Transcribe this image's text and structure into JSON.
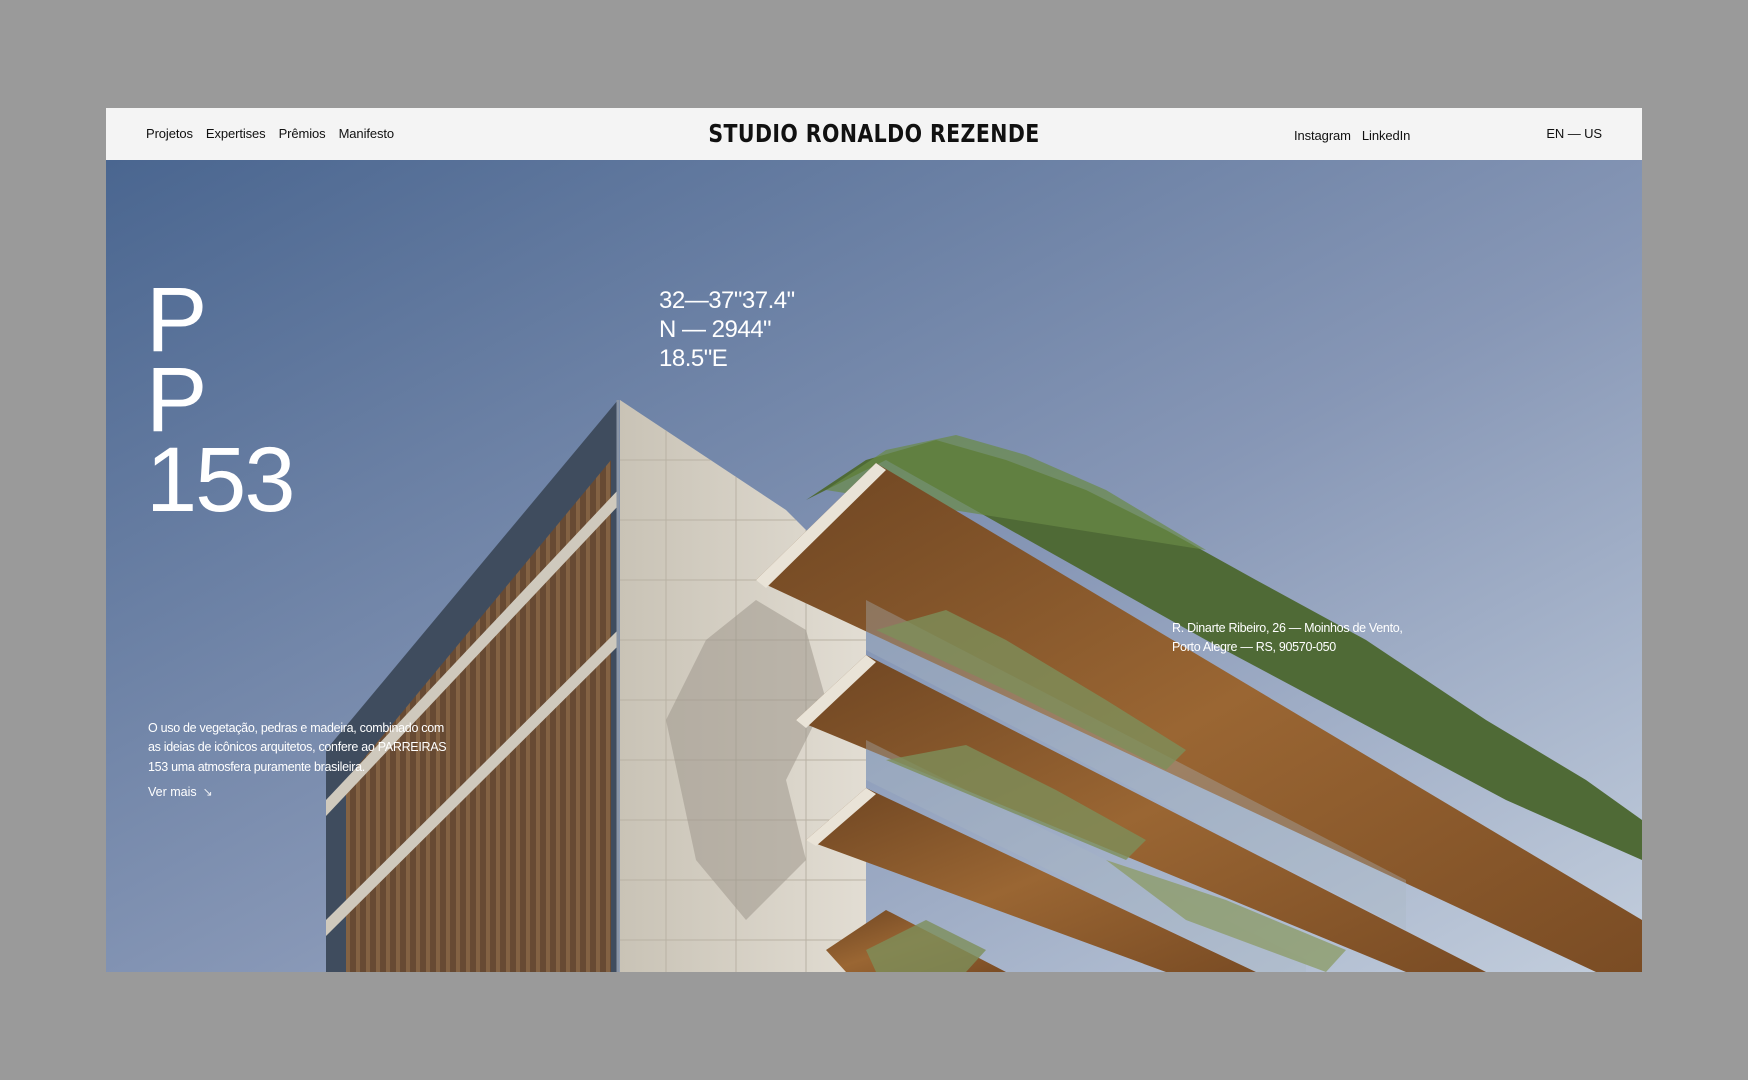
{
  "nav": {
    "items": [
      {
        "label": "Projetos"
      },
      {
        "label": "Expertises"
      },
      {
        "label": "Prêmios"
      },
      {
        "label": "Manifesto"
      }
    ]
  },
  "brand": {
    "logo": "STUDIO RONALDO REZENDE"
  },
  "social": {
    "instagram": "Instagram",
    "linkedin": "LinkedIn"
  },
  "lang": {
    "label": "EN — US"
  },
  "hero": {
    "title_lines": [
      "P",
      "P",
      "153"
    ],
    "coords_lines": [
      "32—37\"37.4\"",
      "N — 2944\"",
      "18.5\"E"
    ],
    "description": "O uso de vegetação, pedras e madeira, combinado com as ideias de icônicos arquitetos, confere ao PARREIRAS 153 uma atmosfera puramente brasileira.",
    "more_label": "Ver mais",
    "more_icon": "arrow-down-right-icon",
    "address_lines": [
      "R. Dinarte Ribeiro, 26 — Moinhos de Vento,",
      "Porto Alegre — RS, 90570-050"
    ]
  },
  "colors": {
    "background": "#9a9a9a",
    "topbar": "#f4f4f4",
    "sky_top": "#4a6690",
    "sky_bottom": "#c3cedd",
    "wood": "#8a5a2e",
    "stone": "#d6d0c4",
    "greenery": "#4f6a36"
  }
}
